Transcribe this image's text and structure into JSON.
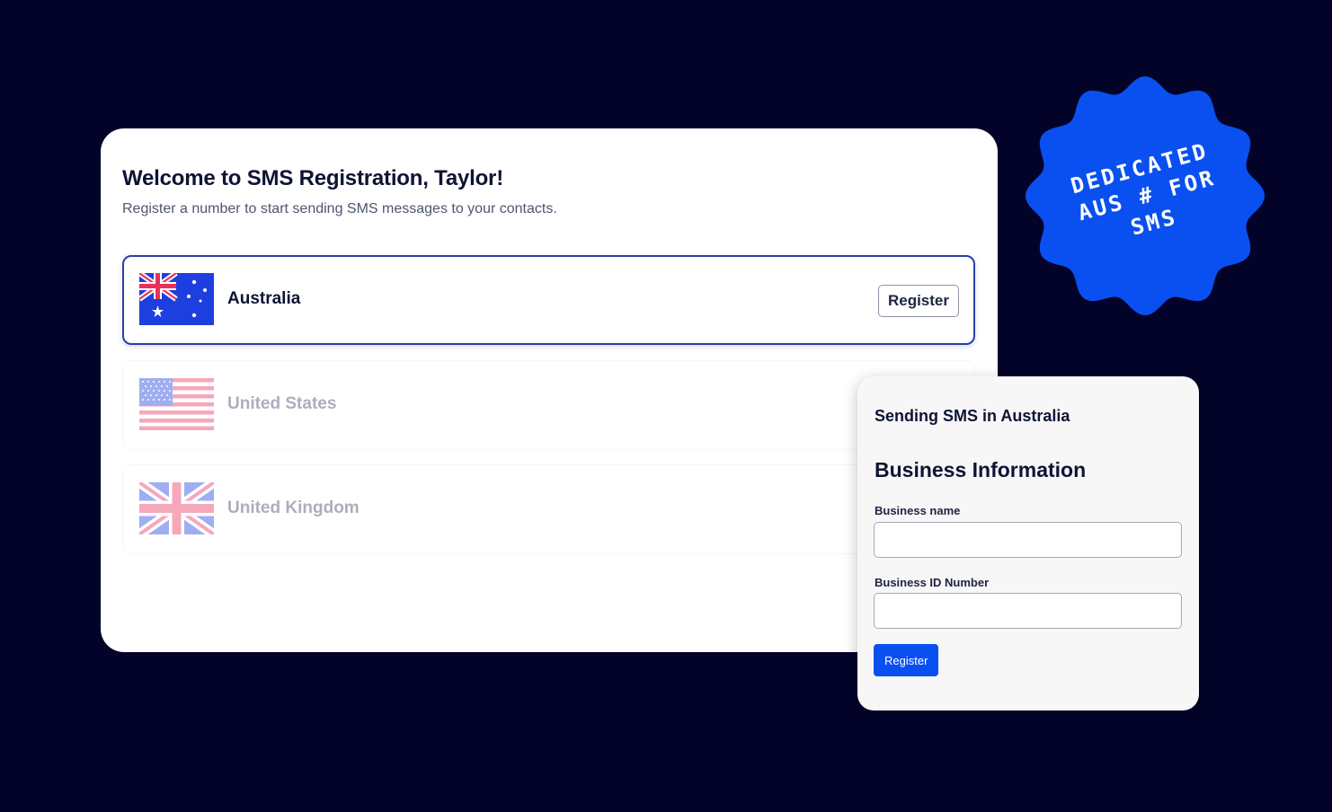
{
  "colors": {
    "background": "#03032a",
    "card": "#ffffff",
    "accent_blue": "#0a50f0",
    "selected_border": "#2a3fa8"
  },
  "registration": {
    "title": "Welcome to SMS Registration, Taylor!",
    "subtitle": "Register a number to start sending SMS messages to your contacts.",
    "countries": [
      {
        "name": "Australia",
        "flag_icon": "australia-flag-icon",
        "selected": true,
        "button_label": "Register"
      },
      {
        "name": "United States",
        "flag_icon": "us-flag-icon",
        "selected": false
      },
      {
        "name": "United Kingdom",
        "flag_icon": "uk-flag-icon",
        "selected": false
      }
    ]
  },
  "business_panel": {
    "title": "Sending SMS in Australia",
    "section_heading": "Business Information",
    "fields": [
      {
        "label": "Business name",
        "value": "",
        "placeholder": ""
      },
      {
        "label": "Business ID Number",
        "value": "",
        "placeholder": ""
      }
    ],
    "submit_label": "Register"
  },
  "badge": {
    "lines": [
      "DEDICATED",
      "AUS # FOR",
      "SMS"
    ]
  }
}
